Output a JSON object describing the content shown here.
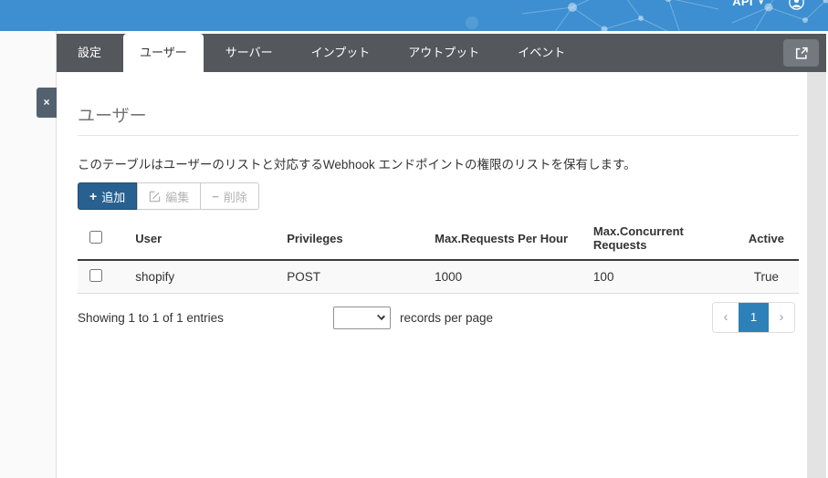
{
  "topbar": {
    "api_label": "API",
    "caret": "▼"
  },
  "tabs": [
    {
      "label": "設定",
      "active": false
    },
    {
      "label": "ユーザー",
      "active": true
    },
    {
      "label": "サーバー",
      "active": false
    },
    {
      "label": "インプット",
      "active": false
    },
    {
      "label": "アウトプット",
      "active": false
    },
    {
      "label": "イベント",
      "active": false
    }
  ],
  "close_label": "×",
  "page": {
    "title": "ユーザー",
    "description": "このテーブルはユーザーのリストと対応するWebhook エンドポイントの権限のリストを保有します。"
  },
  "toolbar": {
    "add_label": "追加",
    "add_plus": "+",
    "edit_label": "編集",
    "delete_label": "削除",
    "delete_minus": "−"
  },
  "table": {
    "columns": [
      "User",
      "Privileges",
      "Max.Requests Per Hour",
      "Max.Concurrent Requests",
      "Active"
    ],
    "rows": [
      {
        "cells": [
          "shopify",
          "POST",
          "1000",
          "100",
          "True"
        ],
        "checked": false
      }
    ]
  },
  "footer": {
    "showing_text": "Showing 1 to 1 of 1 entries",
    "records_per_page_label": "records per page",
    "records_select_value": "",
    "pagination": {
      "prev": "‹",
      "current": "1",
      "next": "›"
    }
  },
  "colors": {
    "topbar": "#3d8fd1",
    "tabbar": "#54585d",
    "add_button": "#286090",
    "active_page": "#2e80b9",
    "close_button": "#52616d",
    "row_stripe": "#f9f9f9"
  }
}
